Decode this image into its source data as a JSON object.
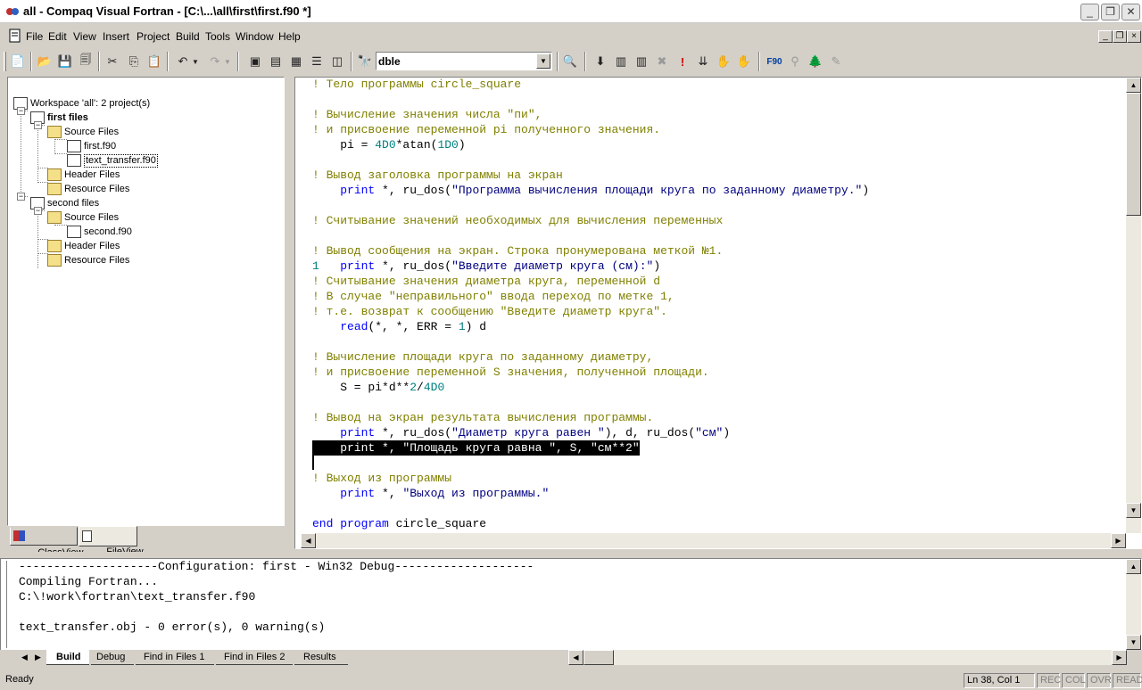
{
  "window": {
    "title": "all - Compaq Visual Fortran - [C:\\...\\all\\first\\first.f90 *]"
  },
  "menu": [
    "File",
    "Edit",
    "View",
    "Insert",
    "Project",
    "Build",
    "Tools",
    "Window",
    "Help"
  ],
  "toolbar": {
    "find_value": "dble"
  },
  "workspace": {
    "root": "Workspace 'all': 2 project(s)",
    "projects": [
      {
        "name": "first files",
        "folders": [
          {
            "name": "Source Files",
            "files": [
              "first.f90",
              "text_transfer.f90"
            ]
          },
          {
            "name": "Header Files"
          },
          {
            "name": "Resource Files"
          }
        ]
      },
      {
        "name": "second files",
        "folders": [
          {
            "name": "Source Files",
            "files": [
              "second.f90"
            ]
          },
          {
            "name": "Header Files"
          },
          {
            "name": "Resource Files"
          }
        ]
      }
    ],
    "tabs": [
      "ClassView",
      "FileView"
    ]
  },
  "editor": {
    "lines": [
      "! Тело программы circle_square",
      "",
      "! Вычисление значения числа \"пи\",",
      "! и присвоение переменной pi полученного значения.",
      "    pi = 4D0*atan(1D0)",
      "",
      "! Вывод заголовка программы на экран",
      "    print *, ru_dos(\"Программа вычисления площади круга по заданному диаметру.\")",
      "",
      "! Считывание значений необходимых для вычисления переменных",
      "",
      "! Вывод сообщения на экран. Строка пронумерована меткой №1.",
      "1   print *, ru_dos(\"Введите диаметр круга (см):\")",
      "! Считывание значения диаметра круга, переменной d",
      "! В случае \"неправильного\" ввода переход по метке 1,",
      "! т.е. возврат к сообщению \"Введите диаметр круга\".",
      "    read(*, *, ERR = 1) d",
      "",
      "! Вычисление площади круга по заданному диаметру,",
      "! и присвоение переменной S значения, полученной площади.",
      "    S = pi*d**2/4D0",
      "",
      "! Вывод на экран результата вычисления программы.",
      "    print *, ru_dos(\"Диаметр круга равен \"), d, ru_dos(\"см\")",
      "    print *, \"Площадь круга равна \", S, \"см**2\"",
      "",
      "! Выход из программы",
      "    print *, \"Выход из программы.\"",
      "",
      "end program circle_square"
    ]
  },
  "output": {
    "lines": [
      "--------------------Configuration: first - Win32 Debug--------------------",
      "Compiling Fortran...",
      "C:\\!work\\fortran\\text_transfer.f90",
      "",
      "text_transfer.obj - 0 error(s), 0 warning(s)"
    ],
    "tabs": [
      "Build",
      "Debug",
      "Find in Files 1",
      "Find in Files 2",
      "Results"
    ]
  },
  "status": {
    "text": "Ready",
    "position": "Ln 38, Col 1",
    "indicators": [
      "REC",
      "COL",
      "OVR",
      "READ"
    ]
  },
  "colors": {
    "comment": "#808000",
    "keyword": "#0000ff",
    "number": "#008080",
    "string": "#000080"
  }
}
